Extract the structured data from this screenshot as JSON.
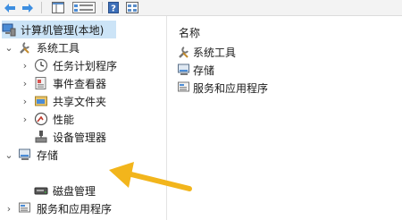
{
  "toolbar": {
    "back_icon": "arrow-left-icon",
    "forward_icon": "arrow-right-icon",
    "up_icon": "console-tree-icon",
    "properties_icon": "properties-icon",
    "help_icon": "help-icon",
    "view_icon": "view-icon"
  },
  "tree": {
    "root_label": "计算机管理(本地)",
    "system_tools": {
      "label": "系统工具",
      "children": [
        {
          "label": "任务计划程序",
          "icon": "clock-icon"
        },
        {
          "label": "事件查看器",
          "icon": "event-viewer-icon"
        },
        {
          "label": "共享文件夹",
          "icon": "shared-folder-icon"
        },
        {
          "label": "性能",
          "icon": "performance-icon"
        },
        {
          "label": "设备管理器",
          "icon": "device-manager-icon"
        }
      ]
    },
    "storage": {
      "label": "存储",
      "children": [
        {
          "label": "磁盘管理",
          "icon": "disk-management-icon"
        }
      ]
    },
    "services": {
      "label": "服务和应用程序"
    }
  },
  "list": {
    "header": "名称",
    "items": [
      {
        "label": "系统工具",
        "icon": "tools-icon"
      },
      {
        "label": "存储",
        "icon": "storage-icon"
      },
      {
        "label": "服务和应用程序",
        "icon": "services-icon"
      }
    ]
  },
  "colors": {
    "selection": "#cce4f7",
    "arrow": "#f2b51c",
    "toolbar_arrow": "#2b7bd3"
  }
}
